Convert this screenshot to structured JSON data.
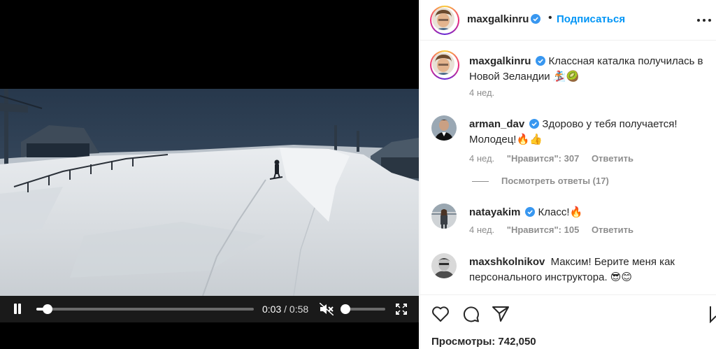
{
  "video": {
    "current_time": "0:03",
    "duration": "/ 0:58",
    "progress": 0.05,
    "volume_level": 0.0,
    "muted": true
  },
  "post": {
    "author": "maxgalkinru",
    "follow_label": "Подписаться",
    "caption": "Классная каталка получилась в Новой Зеландии 🏂🥝",
    "time_ago": "4 нед."
  },
  "comments": [
    {
      "username": "arman_dav",
      "text": "Здорово у тебя получается! Молодец!🔥👍",
      "time_ago": "4 нед.",
      "likes": "\"Нравится\": 307",
      "reply_label": "Ответить"
    },
    {
      "username": "natayakim",
      "text": "Класс!🔥",
      "time_ago": "4 нед.",
      "likes": "\"Нравится\": 105",
      "reply_label": "Ответить"
    },
    {
      "username": "maxshkolnikov",
      "text": "Максим! Берите меня как персонального инструктора. 😎😊"
    }
  ],
  "view_replies_label": "Посмотреть ответы (17)",
  "views_label": "Просмотры: 742,050",
  "colors": {
    "link_blue": "#0095f6",
    "text": "#262626",
    "muted_text": "#8e8e8e",
    "verified_blue": "#3897f0"
  },
  "icons": [
    "pause-icon",
    "mute-icon",
    "fullscreen-icon",
    "verified-icon",
    "more-icon",
    "heart-icon",
    "comment-icon",
    "share-icon",
    "bookmark-icon"
  ]
}
